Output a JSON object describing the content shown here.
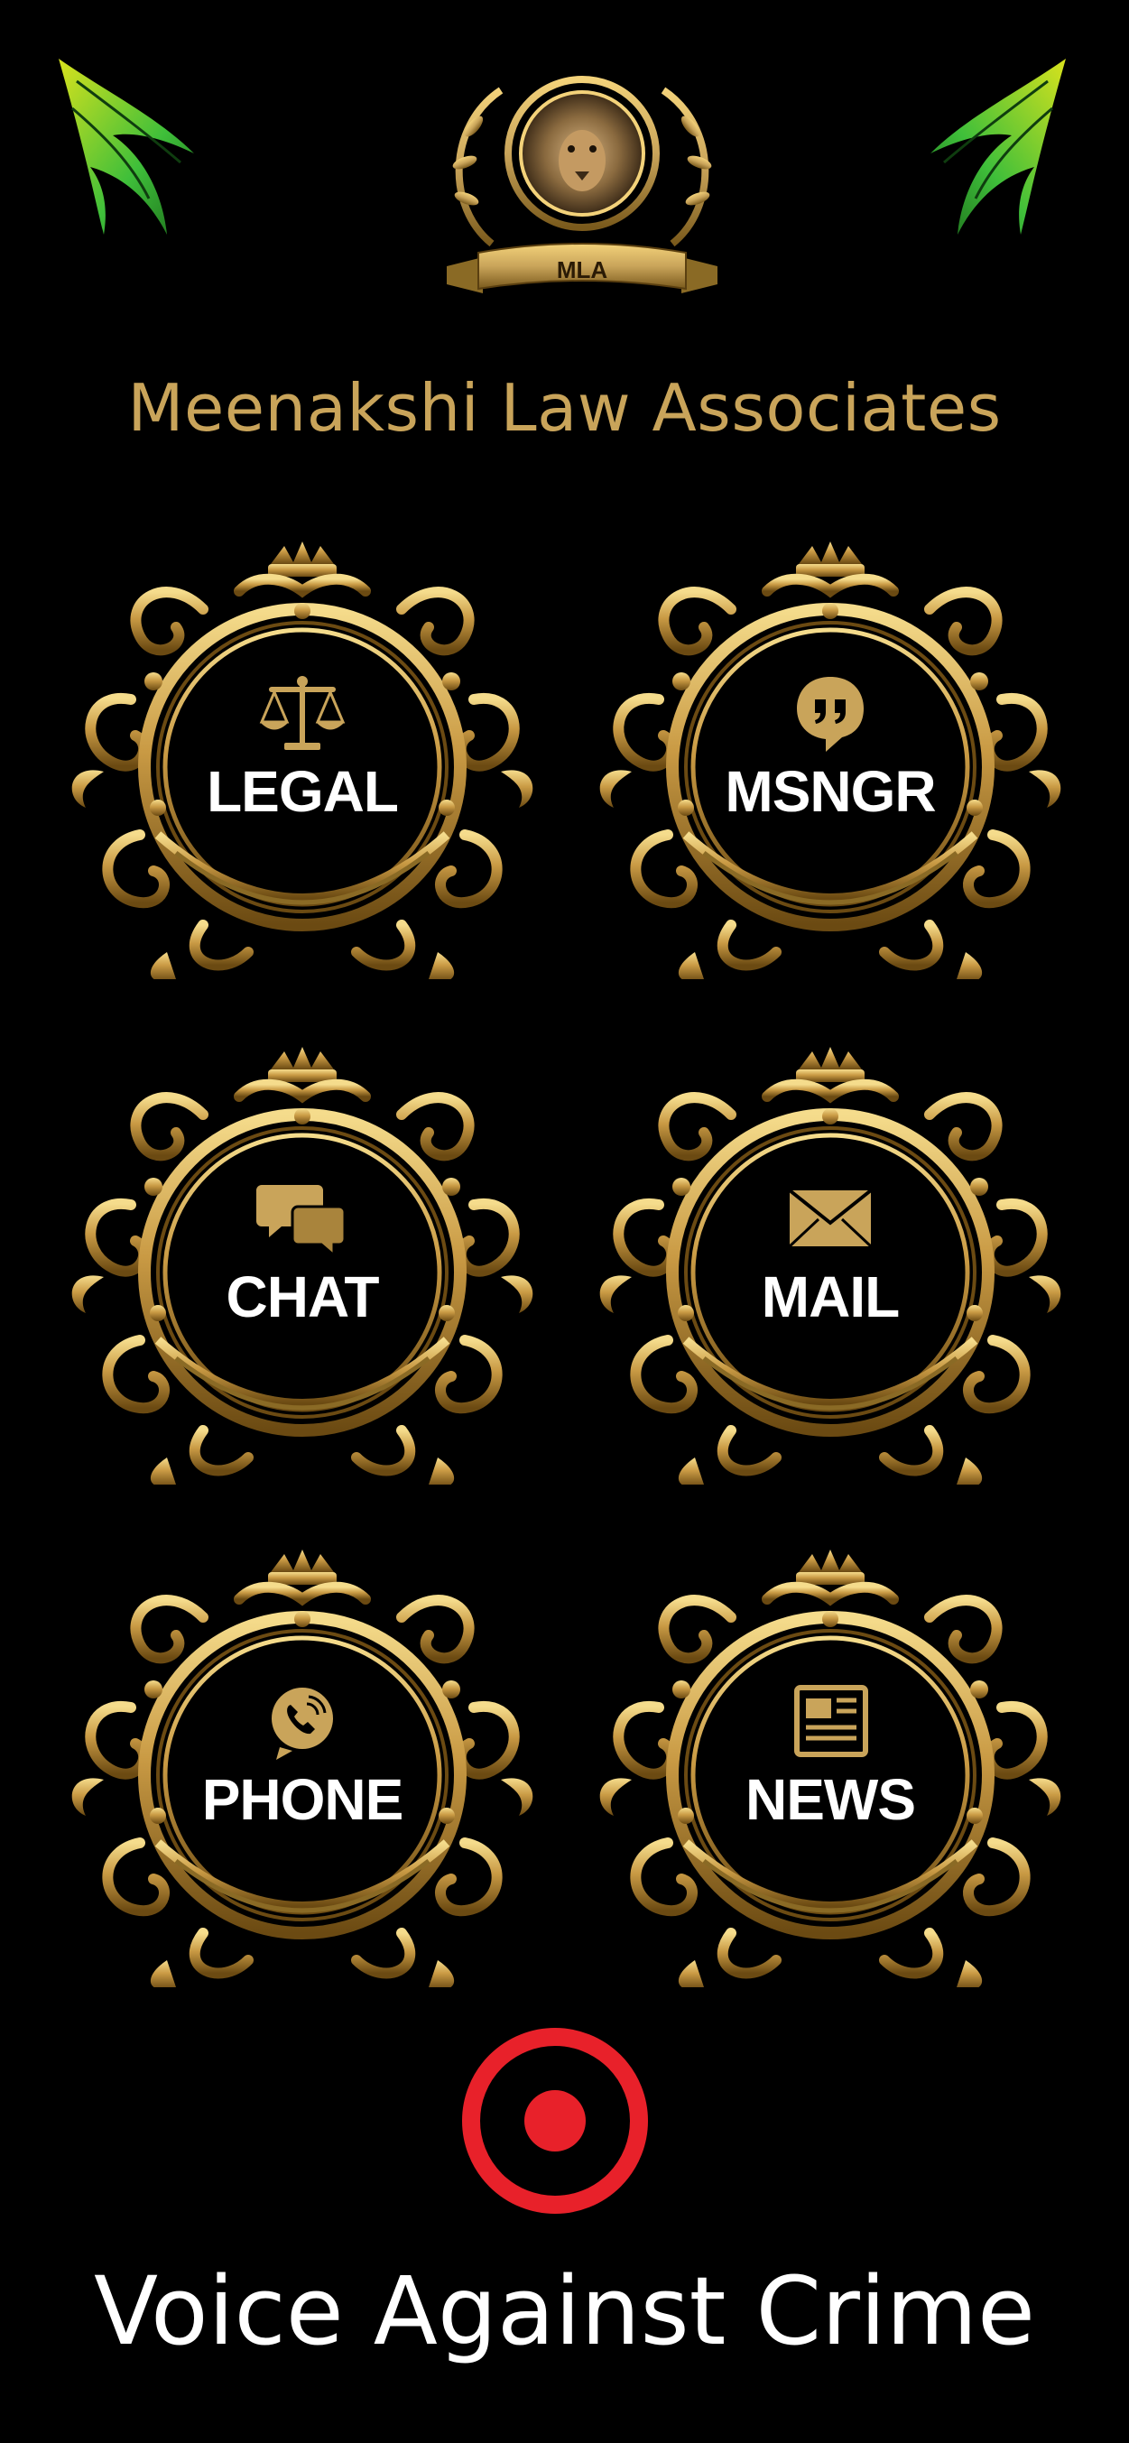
{
  "header": {
    "logo_text": "MLA",
    "title": "Meenakshi Law Associates"
  },
  "menu": [
    {
      "label": "LEGAL",
      "icon": "scales-icon"
    },
    {
      "label": "MSNGR",
      "icon": "quote-bubble-icon"
    },
    {
      "label": "CHAT",
      "icon": "chat-bubbles-icon"
    },
    {
      "label": "MAIL",
      "icon": "envelope-icon"
    },
    {
      "label": "PHONE",
      "icon": "phone-icon"
    },
    {
      "label": "NEWS",
      "icon": "newspaper-icon"
    }
  ],
  "footer": {
    "record_icon": "record-icon",
    "tagline": "Voice Against Crime"
  },
  "colors": {
    "background": "#000000",
    "gold": "#c9a45a",
    "gold_dark": "#8a6a25",
    "record_red": "#e8212a",
    "bird_green": "#3fbf3a",
    "bird_yellow": "#d9e21d"
  }
}
